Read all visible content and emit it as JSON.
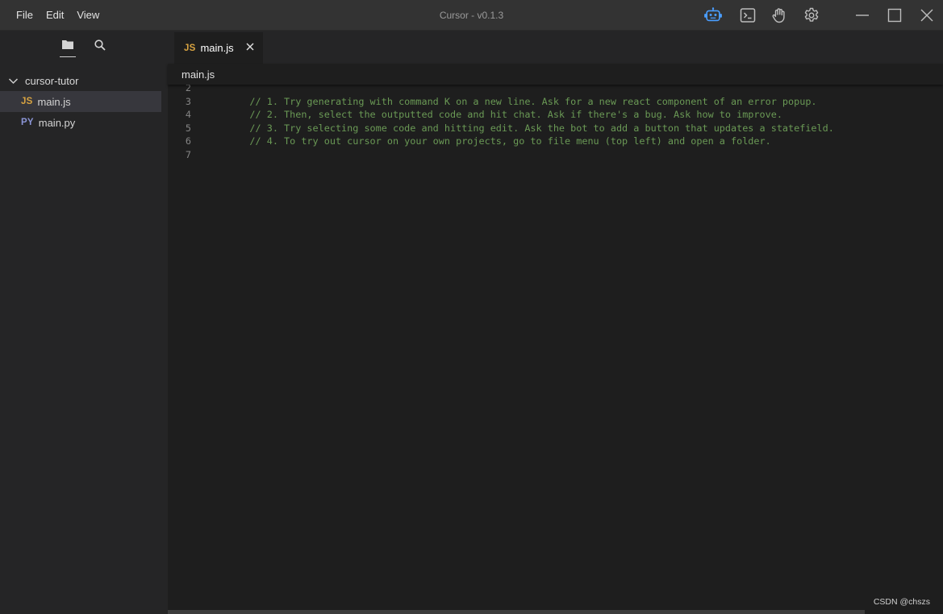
{
  "menu": {
    "file": "File",
    "edit": "Edit",
    "view": "View"
  },
  "window": {
    "title": "Cursor - v0.1.3"
  },
  "toolbar_icons": [
    "robot-icon",
    "terminal-icon",
    "hand-icon",
    "gear-icon"
  ],
  "window_controls": [
    "minimize-icon",
    "maximize-icon",
    "close-icon"
  ],
  "colors": {
    "accent_blue": "#4a9eff",
    "comment_green": "#6a9955",
    "js_badge": "#d9a441",
    "py_badge": "#8b95d6"
  },
  "sidebar": {
    "tabs": [
      "folder-icon",
      "search-icon"
    ],
    "folder": "cursor-tutor",
    "files": [
      {
        "badge": "JS",
        "name": "main.js",
        "selected": true
      },
      {
        "badge": "PY",
        "name": "main.py",
        "selected": false
      }
    ]
  },
  "editor": {
    "tab": {
      "badge": "JS",
      "name": "main.js"
    },
    "breadcrumb": "main.js",
    "lines": [
      {
        "num": "2",
        "text": ""
      },
      {
        "num": "3",
        "text": "    // 1. Try generating with command K on a new line. Ask for a new react component of an error popup."
      },
      {
        "num": "4",
        "text": "    // 2. Then, select the outputted code and hit chat. Ask if there's a bug. Ask how to improve."
      },
      {
        "num": "5",
        "text": "    // 3. Try selecting some code and hitting edit. Ask the bot to add a button that updates a statefield."
      },
      {
        "num": "6",
        "text": "    // 4. To try out cursor on your own projects, go to file menu (top left) and open a folder."
      },
      {
        "num": "7",
        "text": ""
      }
    ]
  },
  "watermark": "CSDN @chszs"
}
